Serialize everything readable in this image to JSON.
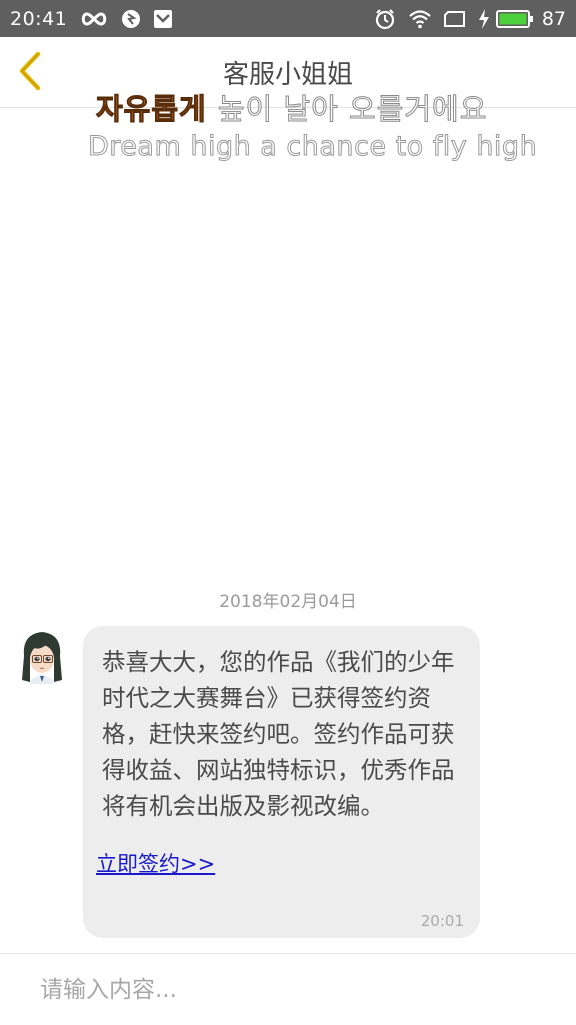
{
  "status_bar": {
    "time": "20:41",
    "battery_percent": "87",
    "icons": [
      "infinity-icon",
      "shield-icon",
      "inbox-icon",
      "alarm-icon",
      "wifi-icon",
      "sim-icon",
      "charging-icon",
      "battery-icon"
    ]
  },
  "header": {
    "title": "客服小姐姐",
    "back_icon": "chevron-left-icon",
    "back_color": "#e6b800"
  },
  "watermark": {
    "korean_accent": "자유롭게",
    "korean_rest": "높이 날아 오를거에요",
    "english": "Dream high a chance to fly high"
  },
  "chat": {
    "date": "2018年02月04日",
    "messages": [
      {
        "sender_avatar": "avatar-girl",
        "text": "恭喜大大，您的作品《我们的少年时代之大赛舞台》已获得签约资格，赶快来签约吧。签约作品可获得收益、网站独特标识，优秀作品将有机会出版及影视改编。",
        "link_text": "立即签约>>",
        "time": "20:01"
      }
    ]
  },
  "input": {
    "placeholder": "请输入内容..."
  },
  "colors": {
    "status_bar_bg": "#5f5f5f",
    "bubble_bg": "#ededed",
    "link": "#1a1acc",
    "accent_orange": "#e07a22"
  }
}
